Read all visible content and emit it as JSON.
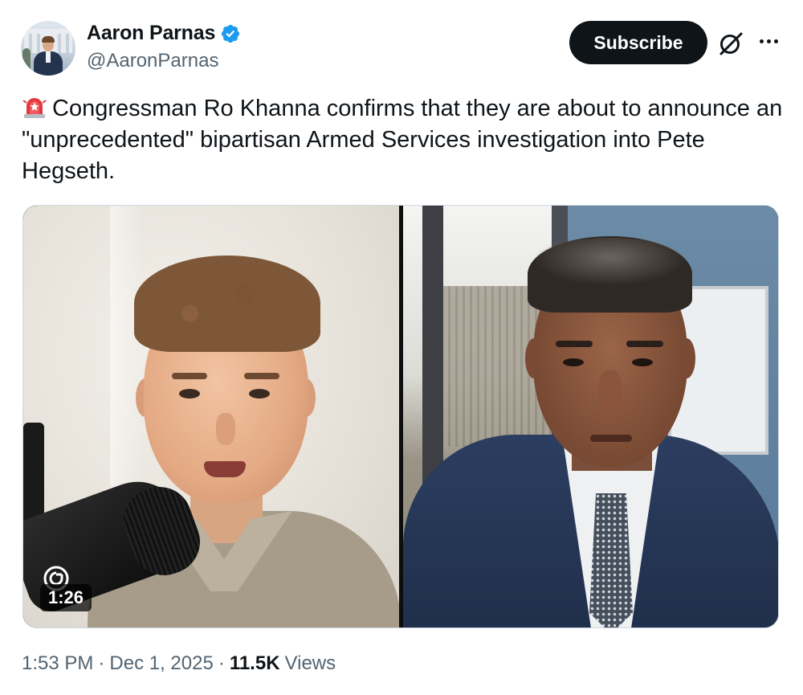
{
  "author": {
    "display_name": "Aaron Parnas",
    "handle": "@AaronParnas",
    "verified": true,
    "verified_color": "#1d9bf0",
    "avatar_icon": "profile-photo"
  },
  "actions": {
    "subscribe_label": "Subscribe",
    "grok_icon": "grok-icon",
    "more_icon": "more-icon"
  },
  "tweet": {
    "emoji": "rotating-light-emoji",
    "text": "Congressman Ro Khanna confirms that they are about to announce an \"unprecedented\" bipartisan Armed Services investigation into Pete Hegseth."
  },
  "media": {
    "type": "video",
    "duration": "1:26",
    "badge_icon": "g-logo-icon"
  },
  "meta": {
    "time": "1:53 PM",
    "separator": "·",
    "date": "Dec 1, 2025",
    "views_count": "11.5K",
    "views_label": "Views"
  },
  "colors": {
    "text_primary": "#0f1419",
    "text_secondary": "#536471",
    "subscribe_bg": "#0f1419",
    "border": "#cfd9de"
  }
}
